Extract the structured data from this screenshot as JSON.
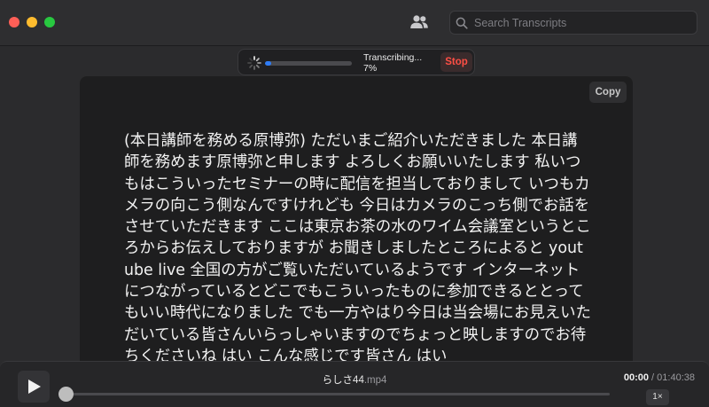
{
  "window": {
    "controls": [
      "close",
      "minimize",
      "zoom"
    ]
  },
  "toolbar": {
    "speakers_icon": "people-icon",
    "search": {
      "placeholder": "Search Transcripts",
      "value": ""
    }
  },
  "progress": {
    "status": "Transcribing...",
    "percent_text": "7%",
    "fraction": 0.07,
    "stop_label": "Stop",
    "accent": "#2e7cf6",
    "stop_color": "#ff4f45"
  },
  "transcript": {
    "copy_label": "Copy",
    "text": "(本日講師を務める原博弥) ただいまご紹介いただきました 本日講師を務めます原博弥と申します よろしくお願いいたします 私いつもはこういったセミナーの時に配信を担当しておりまして いつもカメラの向こう側なんですけれども 今日はカメラのこっち側でお話をさせていただきます ここは東京お茶の水のワイム会議室というところからお伝えしておりますが お聞きしましたところによると youtube live 全国の方がご覧いただいているようです インターネットにつながっているとどこでもこういったものに参加できるととってもいい時代になりました でも一方やはり今日は当会場にお見えいただいている皆さんいらっしゃいますのでちょっと映しますのでお待ちくださいね はい こんな感じです皆さん はい"
  },
  "player": {
    "play_icon": "play-icon",
    "file_base": "らしさ44",
    "file_ext": ".mp4",
    "current_time": "00:00",
    "separator": " / ",
    "total_time": "01:40:38",
    "position_fraction": 0.0,
    "speed_label": "1×"
  }
}
